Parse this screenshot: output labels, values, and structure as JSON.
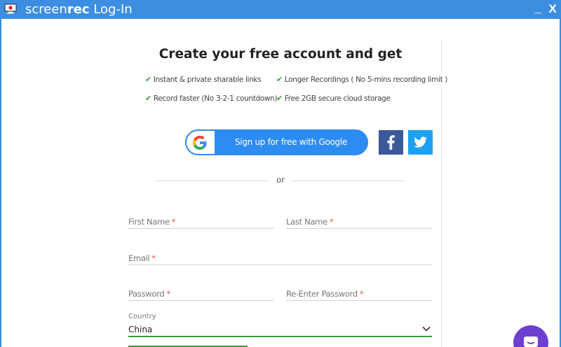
{
  "window": {
    "title_brand_light": "screen",
    "title_brand_bold": "rec",
    "title_rest": " Log-In",
    "minimize_label": "_",
    "close_label": "X",
    "app_icon": "monitor-rec-icon"
  },
  "heading": "Create your free account and get",
  "features": [
    {
      "check": "✔",
      "text": "Instant & private sharable links"
    },
    {
      "check": "✔",
      "text": "Longer Recordings ( No 5-mins recording limit )"
    },
    {
      "check": "✔",
      "text": "Record faster (No 3-2-1 countdown)"
    },
    {
      "check": "✔",
      "text": "Free 2GB secure cloud storage"
    }
  ],
  "social": {
    "google_label": "Sign up for free with Google",
    "google_icon": "google-g-icon",
    "facebook_icon": "facebook-icon",
    "twitter_icon": "twitter-icon"
  },
  "divider_text": "or",
  "form": {
    "first_name": "First Name",
    "last_name": "Last Name",
    "email": "Email",
    "password": "Password",
    "re_password": "Re-Enter Password",
    "required_mark": "*",
    "country_label": "Country",
    "country_value": "China"
  },
  "chat": {
    "icon": "chat-bubble-icon"
  },
  "colors": {
    "titlebar": "#3d8ee0",
    "google_button": "#2d8cf2",
    "facebook": "#3b5998",
    "twitter": "#1da1f2",
    "check": "#3a9a3a",
    "chat": "#6c3fd1",
    "required": "#d9534f"
  }
}
